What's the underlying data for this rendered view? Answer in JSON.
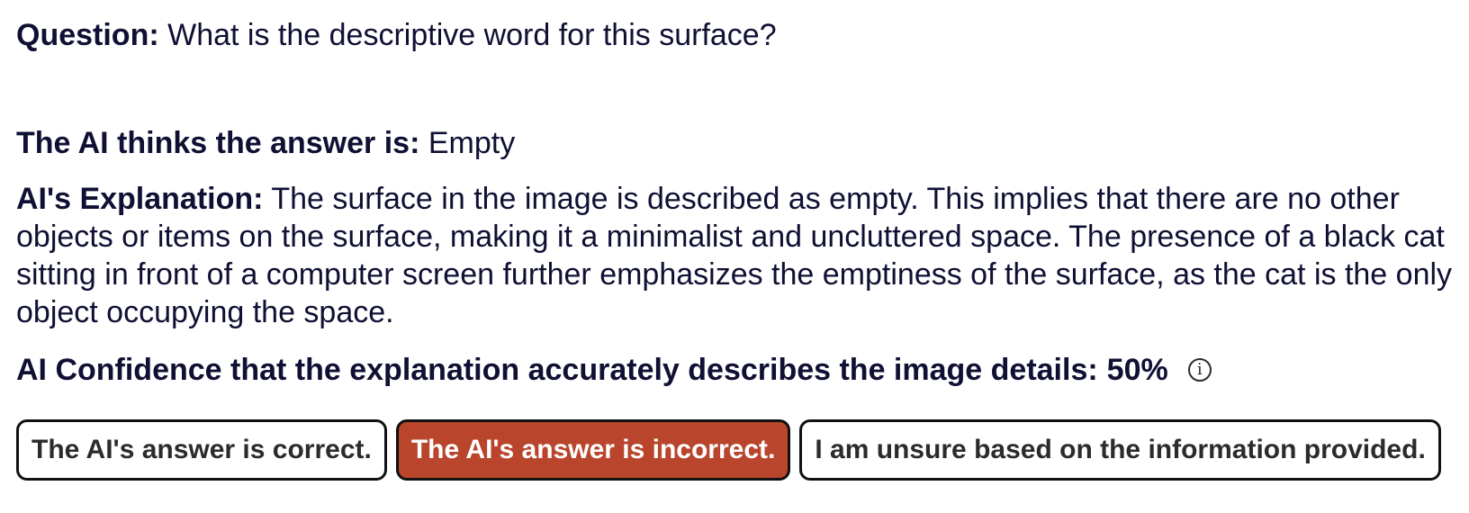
{
  "question": {
    "label": "Question:",
    "text": "What is the descriptive word for this surface?"
  },
  "answer": {
    "label": "The AI thinks the answer is:",
    "text": "Empty"
  },
  "explanation": {
    "label": "AI's Explanation:",
    "text": "The surface in the image is described as empty. This implies that there are no other objects or items on the surface, making it a minimalist and uncluttered space. The presence of a black cat sitting in front of a computer screen further emphasizes the emptiness of the surface, as the cat is the only object occupying the space."
  },
  "confidence": {
    "label": "AI Confidence that the explanation accurately describes the image details:",
    "value": "50%",
    "info_icon": "info-icon"
  },
  "buttons": {
    "correct": "The AI's answer is correct.",
    "incorrect": "The AI's answer is incorrect.",
    "unsure": "I am unsure based on the information provided.",
    "selected": "incorrect"
  },
  "colors": {
    "text": "#0f1033",
    "selected_button": "#b8452c"
  }
}
